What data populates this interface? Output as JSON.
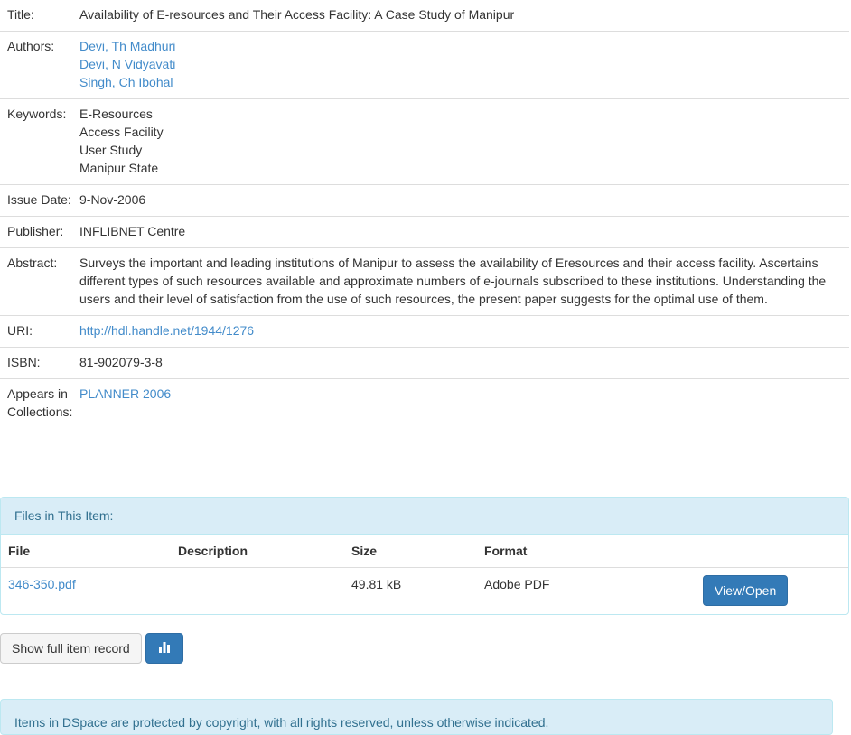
{
  "item": {
    "title_label": "Title:",
    "title": "Availability of E-resources and Their Access Facility: A Case Study of Manipur",
    "authors_label": "Authors:",
    "authors": [
      "Devi, Th Madhuri",
      "Devi, N Vidyavati",
      "Singh, Ch Ibohal"
    ],
    "keywords_label": "Keywords:",
    "keywords": [
      "E-Resources",
      "Access Facility",
      "User Study",
      "Manipur State"
    ],
    "issue_date_label": "Issue Date:",
    "issue_date": "9-Nov-2006",
    "publisher_label": "Publisher:",
    "publisher": "INFLIBNET Centre",
    "abstract_label": "Abstract:",
    "abstract": "Surveys the important and leading institutions of Manipur to assess the availability of Eresources and their access facility. Ascertains different types of such resources available and approximate numbers of e-journals subscribed to these institutions. Understanding the users and their level of satisfaction from the use of such resources, the present paper suggests for the optimal use of them.",
    "uri_label": "URI:",
    "uri": "http://hdl.handle.net/1944/1276",
    "isbn_label": "ISBN:",
    "isbn": "81-902079-3-8",
    "collections_label": "Appears in Collections:",
    "collection": "PLANNER 2006"
  },
  "files": {
    "heading": "Files in This Item:",
    "columns": [
      "File",
      "Description",
      "Size",
      "Format"
    ],
    "rows": [
      {
        "file": "346-350.pdf",
        "description": "",
        "size": "49.81 kB",
        "format": "Adobe PDF",
        "action": "View/Open"
      }
    ]
  },
  "actions": {
    "show_full_record": "Show full item record",
    "stats_icon": "bar-chart-icon"
  },
  "footer": {
    "copyright": "Items in DSpace are protected by copyright, with all rights reserved, unless otherwise indicated."
  },
  "colors": {
    "link": "#428bca",
    "panel_heading_bg": "#d9edf7",
    "panel_heading_text": "#31708f",
    "primary_button": "#337ab7"
  }
}
